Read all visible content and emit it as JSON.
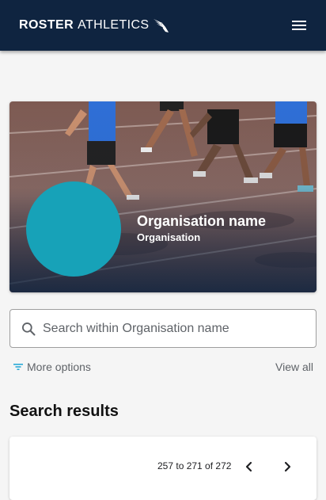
{
  "header": {
    "logo_bold": "ROSTER",
    "logo_light": "ATHLETICS",
    "menu_icon": "hamburger-menu-icon"
  },
  "hero": {
    "org_name": "Organisation name",
    "org_type": "Organisation",
    "avatar_color": "#17a2b8"
  },
  "search": {
    "placeholder": "Search within Organisation name",
    "value": ""
  },
  "filters": {
    "more_options_label": "More options",
    "view_all_label": "View all"
  },
  "results": {
    "title": "Search results",
    "range_label": "257 to 271 of 272",
    "prev_icon": "chevron-left-icon",
    "next_icon": "chevron-right-icon"
  },
  "colors": {
    "header_bg": "#0f2440",
    "accent": "#17a2b8",
    "filter_icon": "#29a9d6"
  }
}
